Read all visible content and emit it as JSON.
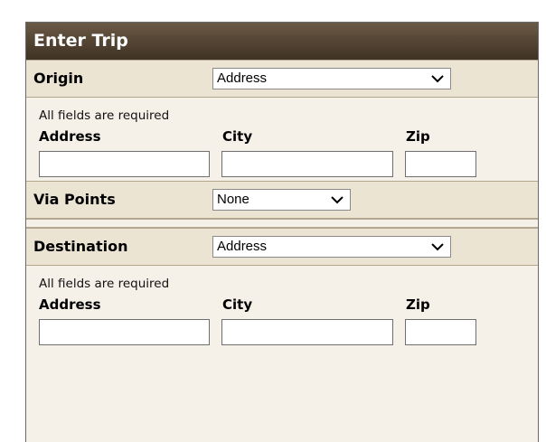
{
  "panel": {
    "title": "Enter Trip"
  },
  "origin": {
    "label": "Origin",
    "select_value": "Address",
    "note": "All fields are required",
    "columns": {
      "address": "Address",
      "city": "City",
      "zip": "Zip"
    }
  },
  "via": {
    "label": "Via Points",
    "select_value": "None"
  },
  "destination": {
    "label": "Destination",
    "select_value": "Address",
    "note": "All fields are required",
    "columns": {
      "address": "Address",
      "city": "City",
      "zip": "Zip"
    }
  },
  "icons": {
    "dropdown": "chevron-down-icon"
  }
}
